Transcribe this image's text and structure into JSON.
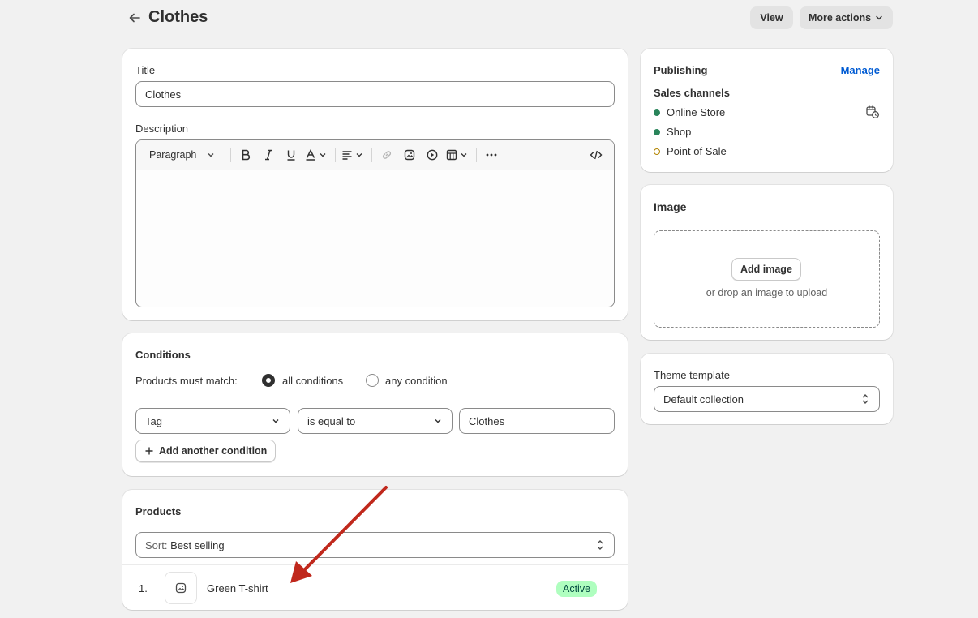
{
  "header": {
    "title": "Clothes",
    "view_label": "View",
    "more_actions_label": "More actions"
  },
  "main": {
    "title_label": "Title",
    "title_value": "Clothes",
    "description_label": "Description",
    "editor": {
      "paragraph_label": "Paragraph"
    }
  },
  "conditions": {
    "heading": "Conditions",
    "match_label": "Products must match:",
    "option_all": "all conditions",
    "option_any": "any condition",
    "selected": "all conditions",
    "field_select": "Tag",
    "operator_select": "is equal to",
    "value": "Clothes",
    "add_label": "Add another condition"
  },
  "products": {
    "heading": "Products",
    "sort_prefix": "Sort:",
    "sort_value": "Best selling",
    "items": [
      {
        "index": "1.",
        "name": "Green T-shirt",
        "status": "Active"
      }
    ]
  },
  "publishing": {
    "heading": "Publishing",
    "manage_label": "Manage",
    "channels_label": "Sales channels",
    "channels": [
      {
        "name": "Online Store",
        "active": true
      },
      {
        "name": "Shop",
        "active": true
      },
      {
        "name": "Point of Sale",
        "active": false
      }
    ]
  },
  "image": {
    "heading": "Image",
    "add_label": "Add image",
    "drop_text": "or drop an image to upload"
  },
  "theme": {
    "label": "Theme template",
    "value": "Default collection"
  },
  "colors": {
    "active_dot": "#29845a",
    "inactive_dot": "#b28400",
    "annotation_arrow": "#c0281c",
    "link": "#005bd3"
  }
}
